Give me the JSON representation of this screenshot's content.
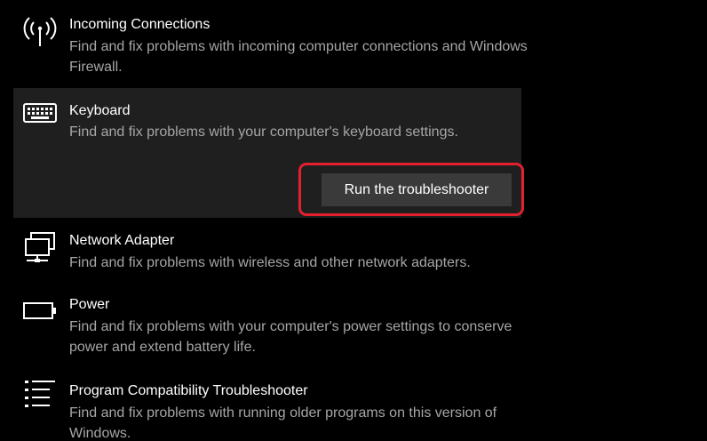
{
  "colors": {
    "background": "#000000",
    "selected_bg": "#1f1f1f",
    "title": "#ffffff",
    "description": "#a6a6a6",
    "button_bg": "#3a3a3a",
    "highlight": "#e4202e"
  },
  "troubleshooters": [
    {
      "icon": "antenna-icon",
      "title": "Incoming Connections",
      "description": "Find and fix problems with incoming computer connections and Windows Firewall."
    },
    {
      "icon": "keyboard-icon",
      "title": "Keyboard",
      "description": "Find and fix problems with your computer's keyboard settings.",
      "selected": true,
      "button_label": "Run the troubleshooter"
    },
    {
      "icon": "network-adapter-icon",
      "title": "Network Adapter",
      "description": "Find and fix problems with wireless and other network adapters."
    },
    {
      "icon": "battery-icon",
      "title": "Power",
      "description": "Find and fix problems with your computer's power settings to conserve power and extend battery life."
    },
    {
      "icon": "list-icon",
      "title": "Program Compatibility Troubleshooter",
      "description": "Find and fix problems with running older programs on this version of Windows."
    }
  ]
}
